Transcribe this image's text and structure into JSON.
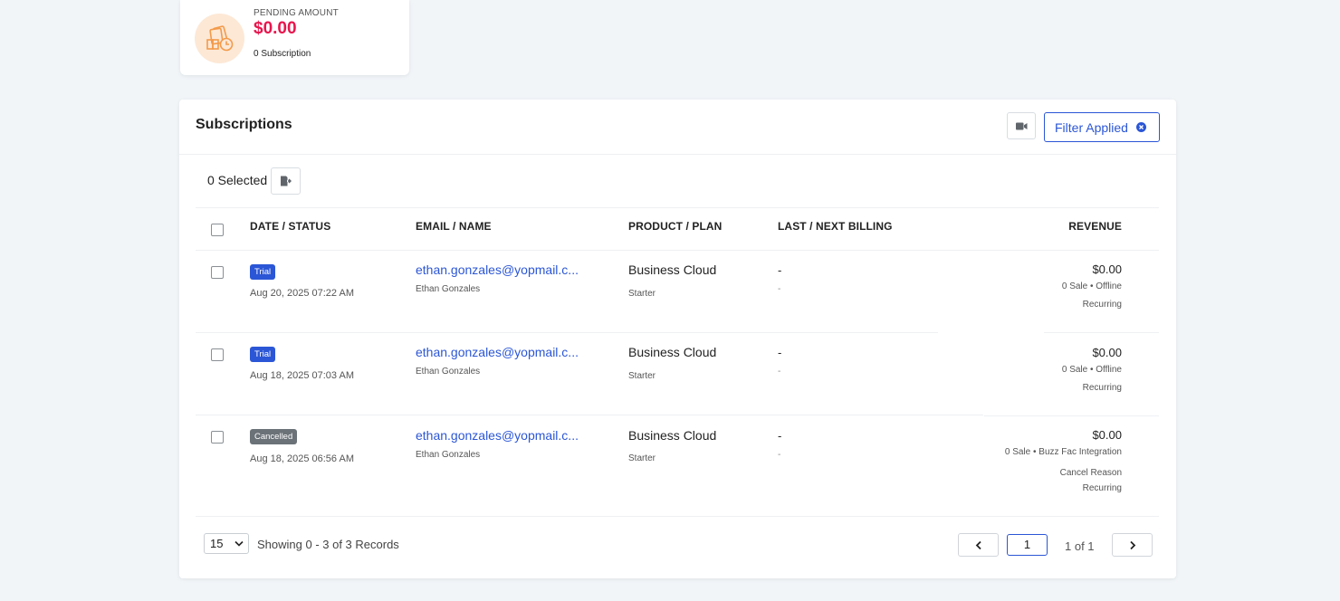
{
  "pending": {
    "label": "PENDING AMOUNT",
    "amount": "$0.00",
    "subscriptions": "0 Subscription",
    "icon": "money-clock-icon",
    "accent_color": "#e8154d",
    "icon_color": "#f39a4a"
  },
  "panel": {
    "title": "Subscriptions",
    "filter_label": "Filter Applied",
    "selected_label": "0 Selected"
  },
  "table": {
    "headers": {
      "date_status": "DATE / STATUS",
      "email_name": "EMAIL / NAME",
      "product_plan": "PRODUCT / PLAN",
      "billing": "LAST / NEXT BILLING",
      "revenue": "REVENUE"
    },
    "rows": [
      {
        "status": "Trial",
        "date": "Aug 20, 2025 07:22 AM",
        "email": "ethan.gonzales@yopmail.c...",
        "name": "Ethan Gonzales",
        "product": "Business Cloud",
        "plan": "Starter",
        "last_billing": "-",
        "next_billing": "-",
        "revenue": "$0.00",
        "revenue_detail": "0 Sale • Offline",
        "revenue_type": "Recurring"
      },
      {
        "status": "Trial",
        "date": "Aug 18, 2025 07:03 AM",
        "email": "ethan.gonzales@yopmail.c...",
        "name": "Ethan Gonzales",
        "product": "Business Cloud",
        "plan": "Starter",
        "last_billing": "-",
        "next_billing": "-",
        "revenue": "$0.00",
        "revenue_detail": "0 Sale • Offline",
        "revenue_type": "Recurring"
      },
      {
        "status": "Cancelled",
        "date": "Aug 18, 2025 06:56 AM",
        "email": "ethan.gonzales@yopmail.c...",
        "name": "Ethan Gonzales",
        "product": "Business Cloud",
        "plan": "Starter",
        "last_billing": "-",
        "next_billing": "-",
        "revenue": "$0.00",
        "revenue_detail": "0 Sale • Buzz Fac Integration",
        "cancel_reason": "Cancel Reason",
        "revenue_type": "Recurring"
      }
    ]
  },
  "footer": {
    "page_size": "15",
    "showing": "Showing 0 - 3 of 3 Records",
    "current_page": "1",
    "page_of": "1 of 1"
  },
  "colors": {
    "primary": "#2b56d6",
    "trial_badge": "#2b56d6",
    "cancelled_badge": "#6b7278"
  }
}
